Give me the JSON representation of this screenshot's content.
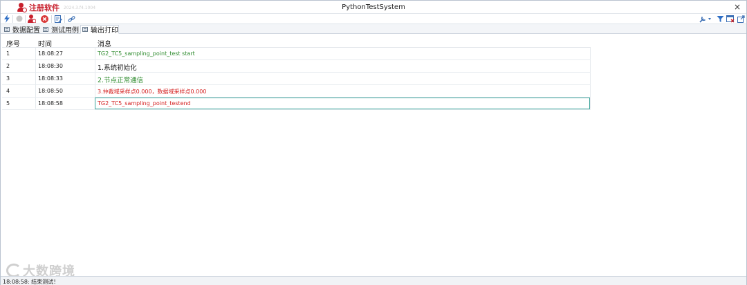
{
  "window": {
    "logo_text": "注册软件",
    "logo_subtext": "2024.3.f4.1004",
    "title": "PythonTestSystem",
    "close_glyph": "×"
  },
  "toolbar": {
    "left_icons": [
      "lightning-icon",
      "circle-icon",
      "user-register-icon",
      "stop-icon",
      "edit-icon",
      "link-icon"
    ],
    "right_icons": [
      "wrench-icon",
      "filter-icon",
      "window-close-icon",
      "export-icon"
    ]
  },
  "tabs": [
    {
      "label": "数据配置"
    },
    {
      "label": "测试用例"
    },
    {
      "label": "输出打印",
      "active": true
    }
  ],
  "table": {
    "headers": {
      "index": "序号",
      "time": "时间",
      "message": "消息"
    },
    "rows": [
      {
        "index": "1",
        "time": "18:08:27",
        "message": "TG2_TC5_sampling_point_test start",
        "color": "#2e8b2e"
      },
      {
        "index": "2",
        "time": "18:08:30",
        "message": "1.系统初始化",
        "color": "#222222"
      },
      {
        "index": "3",
        "time": "18:08:33",
        "message": "2.节点正常通信",
        "color": "#2e8b2e"
      },
      {
        "index": "4",
        "time": "18:08:50",
        "message": "3.仲裁域采样点0.000，数据域采样点0.000",
        "color": "#d42020"
      },
      {
        "index": "5",
        "time": "18:08:58",
        "message": "TG2_TC5_sampling_point_testend",
        "color": "#d42020",
        "selected": true
      }
    ]
  },
  "watermark": "大数跨境",
  "status": {
    "text": "18:08:58: 结束测试！"
  }
}
